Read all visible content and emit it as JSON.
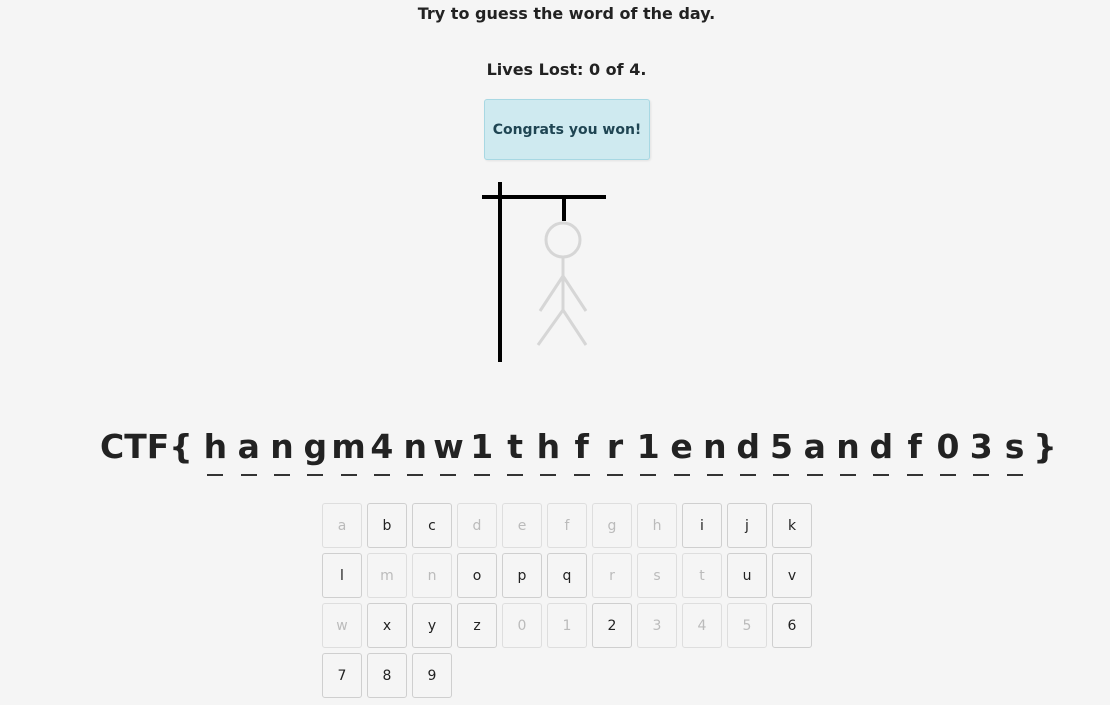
{
  "header": {
    "instruction": "Try to guess the word of the day.",
    "lives_text": "Lives Lost: 0 of 4."
  },
  "alert": {
    "message": "Congrats you won!",
    "color": "#cfeaf0"
  },
  "game": {
    "lives_lost": 0,
    "lives_total": 4,
    "word_prefix": "CTF{",
    "word_suffix": "}",
    "letters": [
      "h",
      "a",
      "n",
      "g",
      "m",
      "4",
      "n",
      "w",
      "1",
      "t",
      "h",
      "f",
      "r",
      "1",
      "e",
      "n",
      "d",
      "5",
      "a",
      "n",
      "d",
      "f",
      "0",
      "3",
      "s"
    ]
  },
  "keyboard": {
    "keys": [
      {
        "label": "a",
        "used": true
      },
      {
        "label": "b",
        "used": false
      },
      {
        "label": "c",
        "used": false
      },
      {
        "label": "d",
        "used": true
      },
      {
        "label": "e",
        "used": true
      },
      {
        "label": "f",
        "used": true
      },
      {
        "label": "g",
        "used": true
      },
      {
        "label": "h",
        "used": true
      },
      {
        "label": "i",
        "used": false
      },
      {
        "label": "j",
        "used": false
      },
      {
        "label": "k",
        "used": false
      },
      {
        "label": "l",
        "used": false
      },
      {
        "label": "m",
        "used": true
      },
      {
        "label": "n",
        "used": true
      },
      {
        "label": "o",
        "used": false
      },
      {
        "label": "p",
        "used": false
      },
      {
        "label": "q",
        "used": false
      },
      {
        "label": "r",
        "used": true
      },
      {
        "label": "s",
        "used": true
      },
      {
        "label": "t",
        "used": true
      },
      {
        "label": "u",
        "used": false
      },
      {
        "label": "v",
        "used": false
      },
      {
        "label": "w",
        "used": true
      },
      {
        "label": "x",
        "used": false
      },
      {
        "label": "y",
        "used": false
      },
      {
        "label": "z",
        "used": false
      },
      {
        "label": "0",
        "used": true
      },
      {
        "label": "1",
        "used": true
      },
      {
        "label": "2",
        "used": false
      },
      {
        "label": "3",
        "used": true
      },
      {
        "label": "4",
        "used": true
      },
      {
        "label": "5",
        "used": true
      },
      {
        "label": "6",
        "used": false
      },
      {
        "label": "7",
        "used": false
      },
      {
        "label": "8",
        "used": false
      },
      {
        "label": "9",
        "used": false
      }
    ]
  }
}
